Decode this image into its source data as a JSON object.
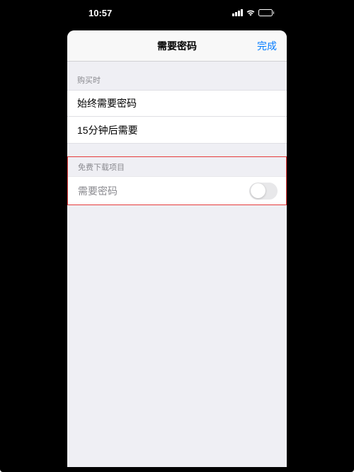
{
  "statusBar": {
    "time": "10:57"
  },
  "header": {
    "title": "需要密码",
    "doneLabel": "完成"
  },
  "sections": {
    "purchase": {
      "label": "购买时",
      "options": [
        {
          "label": "始终需要密码"
        },
        {
          "label": "15分钟后需要"
        }
      ]
    },
    "freeDownloads": {
      "label": "免费下载项目",
      "toggleLabel": "需要密码",
      "toggleOn": false
    }
  },
  "colors": {
    "accent": "#007aff",
    "highlightBorder": "#e63b3b"
  }
}
